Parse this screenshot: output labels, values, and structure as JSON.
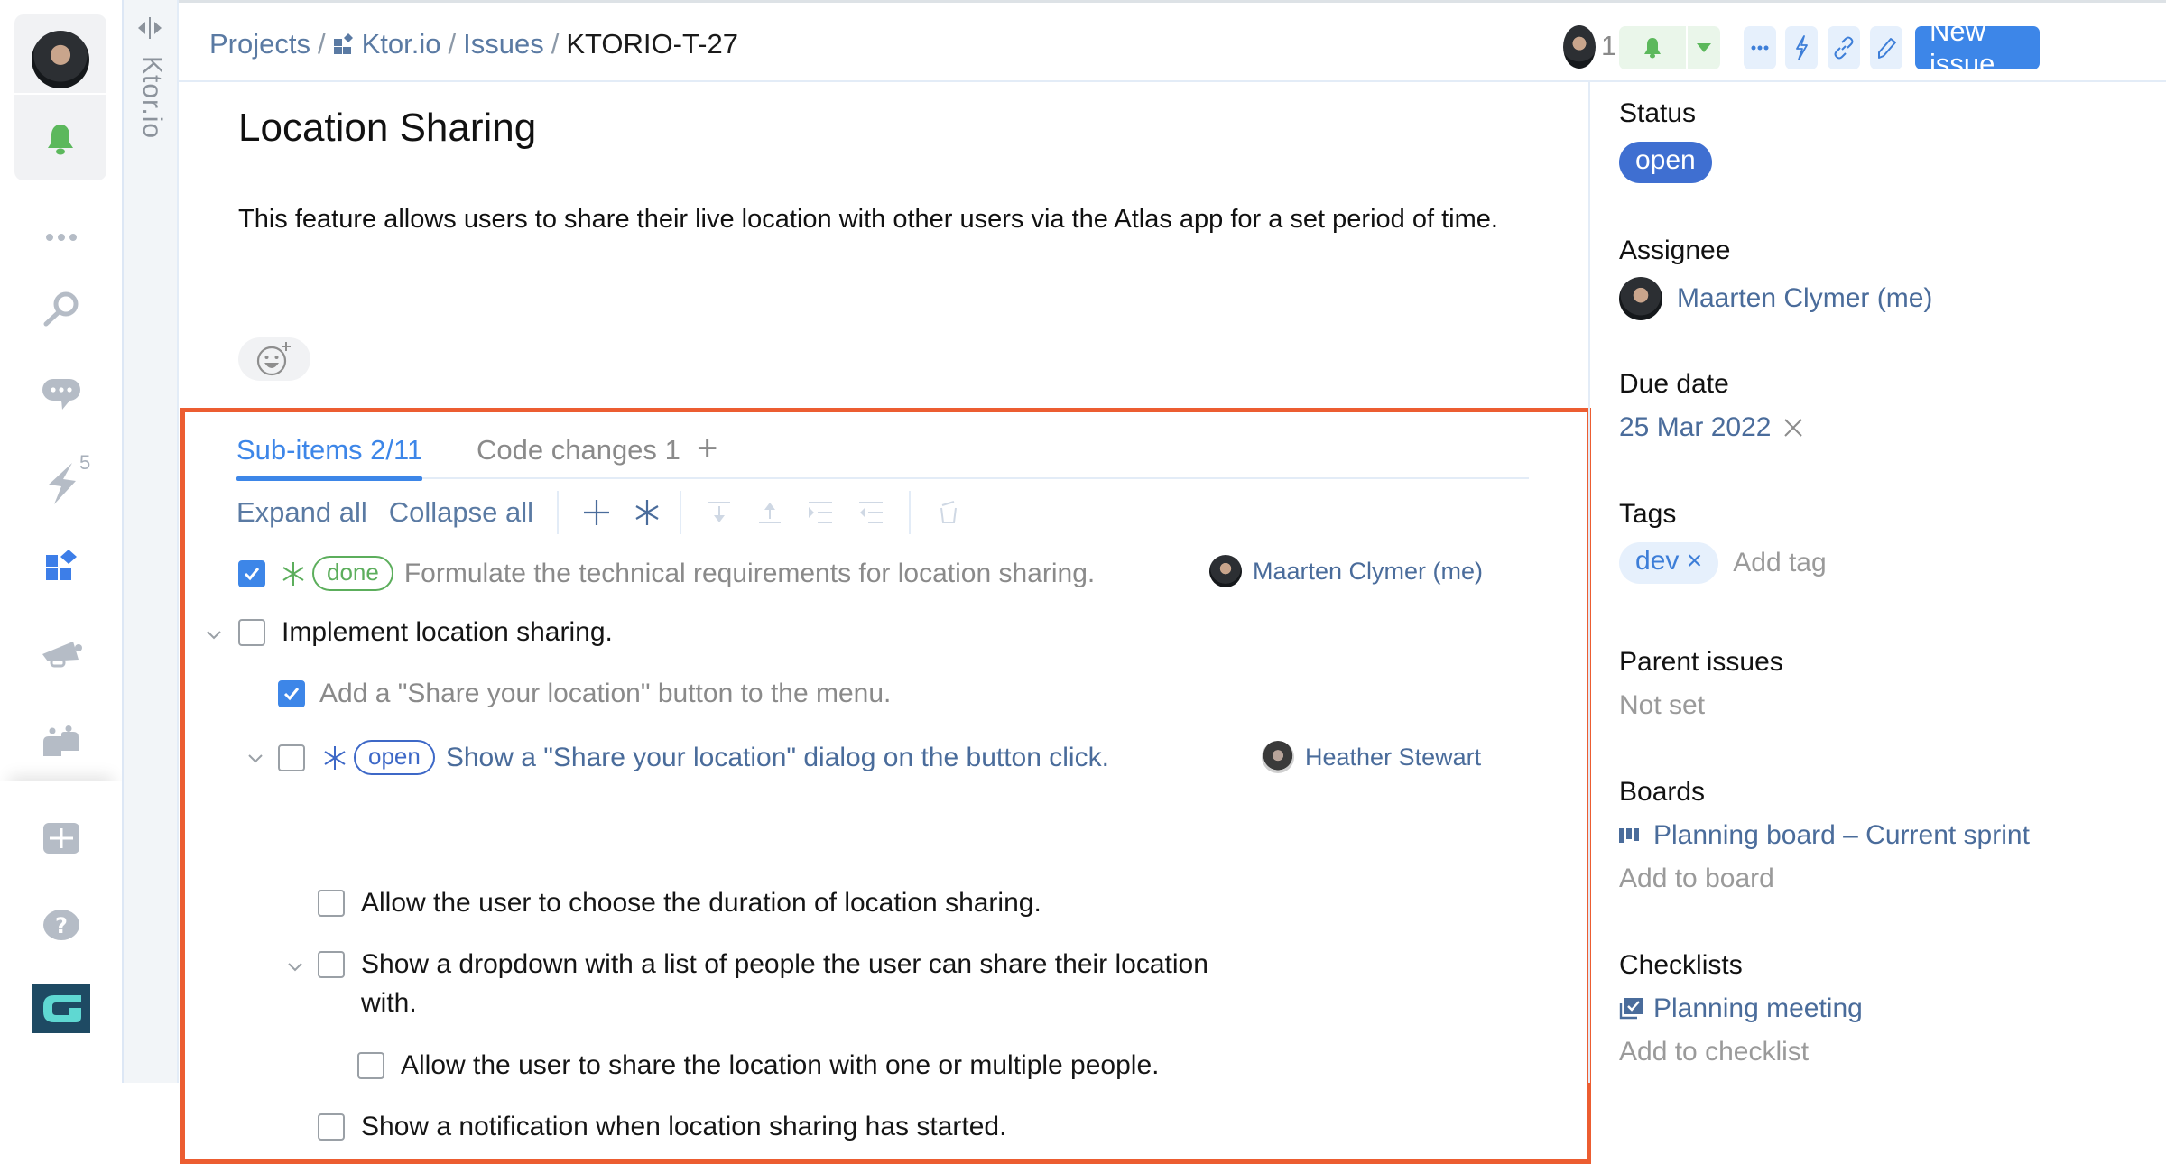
{
  "sidebar": {
    "user_avatar": "user-avatar",
    "notification_icon": "bell-icon",
    "items": [
      {
        "icon": "more-icon"
      },
      {
        "icon": "search-icon"
      },
      {
        "icon": "chat-icon"
      },
      {
        "icon": "lightning-icon",
        "badge": "5"
      },
      {
        "icon": "projects-icon"
      },
      {
        "icon": "megaphone-icon"
      },
      {
        "icon": "team-icon"
      }
    ],
    "bottom": [
      {
        "icon": "add-icon"
      },
      {
        "icon": "help-icon"
      },
      {
        "icon": "org-logo-icon"
      }
    ]
  },
  "project_strip": {
    "label": "Ktor.io"
  },
  "header": {
    "breadcrumb": [
      "Projects",
      "Ktor.io",
      "Issues",
      "KTORIO-T-27"
    ],
    "separator": "/",
    "followers_count": "1",
    "new_issue_label": "New issue"
  },
  "issue": {
    "title": "Location Sharing",
    "description": "This feature allows users to share their live location with other users via the Atlas app for a set period of time."
  },
  "tabs": {
    "sub_items": "Sub-items",
    "sub_items_count": "2/11",
    "code_changes": "Code changes",
    "code_changes_count": "1",
    "add": "+"
  },
  "toolbar": {
    "expand_all": "Expand all",
    "collapse_all": "Collapse all"
  },
  "sub_items": [
    {
      "text": "Formulate the technical requirements for location sharing.",
      "checked": true,
      "status": "done",
      "assignee": "Maarten Clymer (me)",
      "level": 0
    },
    {
      "text": "Implement location sharing.",
      "checked": false,
      "expanded": true,
      "level": 0
    },
    {
      "text": "Add a \"Share your location\" button to the menu.",
      "checked": true,
      "level": 1
    },
    {
      "text": "Show a \"Share your location\" dialog on the button click.",
      "checked": false,
      "status": "open",
      "assignee": "Heather Stewart",
      "expanded": true,
      "level": 1
    },
    {
      "text": "Allow the user to choose the duration of location sharing.",
      "checked": false,
      "level": 2
    },
    {
      "text": "Show a dropdown with a list of people the user can share their location",
      "text_cont": "with.",
      "checked": false,
      "expanded": true,
      "level": 2
    },
    {
      "text": "Allow the user to share the location with one or multiple people.",
      "checked": false,
      "level": 3
    },
    {
      "text": "Show a notification when location sharing has started.",
      "checked": false,
      "level": 2
    }
  ],
  "right_panel": {
    "status_label": "Status",
    "status_value": "open",
    "assignee_label": "Assignee",
    "assignee_value": "Maarten Clymer (me)",
    "due_date_label": "Due date",
    "due_date_value": "25 Mar 2022",
    "tags_label": "Tags",
    "tags": [
      "dev"
    ],
    "add_tag": "Add tag",
    "parent_issues_label": "Parent issues",
    "parent_issues_value": "Not set",
    "boards_label": "Boards",
    "board_value": "Planning board – Current sprint",
    "add_to_board": "Add to board",
    "checklists_label": "Checklists",
    "checklist_value": "Planning meeting",
    "add_to_checklist": "Add to checklist"
  },
  "colors": {
    "accent": "#3d86e8",
    "highlight_border": "#ec5d31",
    "done": "#5cae5c",
    "open": "#3f6fd1",
    "link": "#4a6c9b"
  }
}
